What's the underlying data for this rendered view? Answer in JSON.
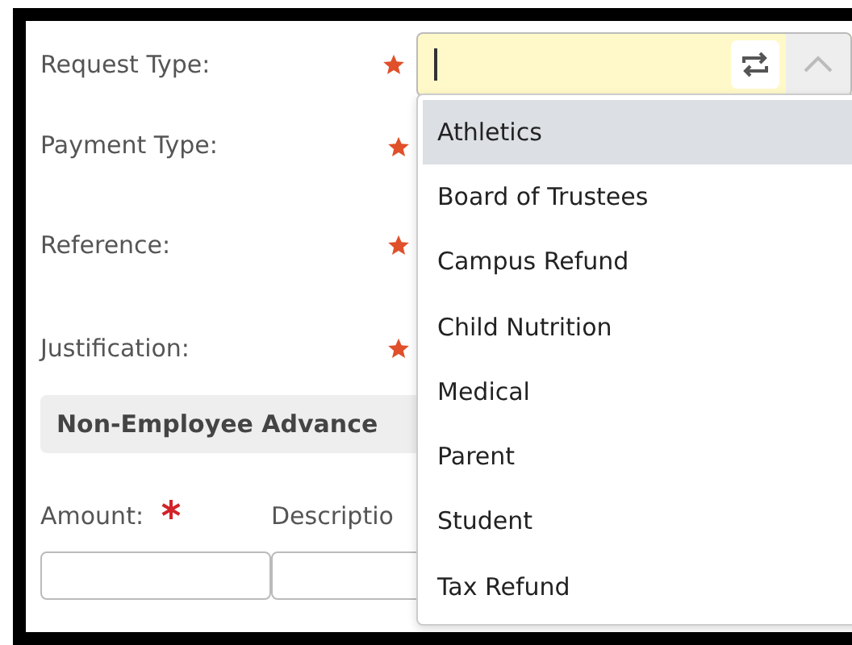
{
  "fields": [
    {
      "label": "Request Type:",
      "required": true,
      "kind": "combobox",
      "focused": true
    },
    {
      "label": "Payment Type:",
      "required": true,
      "kind": "text"
    },
    {
      "label": "Reference:",
      "required": true,
      "kind": "text"
    },
    {
      "label": "Justification:",
      "required": true,
      "kind": "text"
    }
  ],
  "dropdown": {
    "expanded": true,
    "options": [
      {
        "label": "Athletics",
        "selected": true
      },
      {
        "label": "Board of Trustees",
        "selected": false
      },
      {
        "label": "Campus Refund",
        "selected": false
      },
      {
        "label": "Child Nutrition",
        "selected": false
      },
      {
        "label": "Medical",
        "selected": false
      },
      {
        "label": "Parent",
        "selected": false
      },
      {
        "label": "Student",
        "selected": false
      },
      {
        "label": "Tax Refund",
        "selected": false
      }
    ]
  },
  "section": {
    "title": "Non-Employee Advance"
  },
  "columns": [
    {
      "label": "Amount:",
      "required": true
    },
    {
      "label": "Descriptio"
    }
  ]
}
